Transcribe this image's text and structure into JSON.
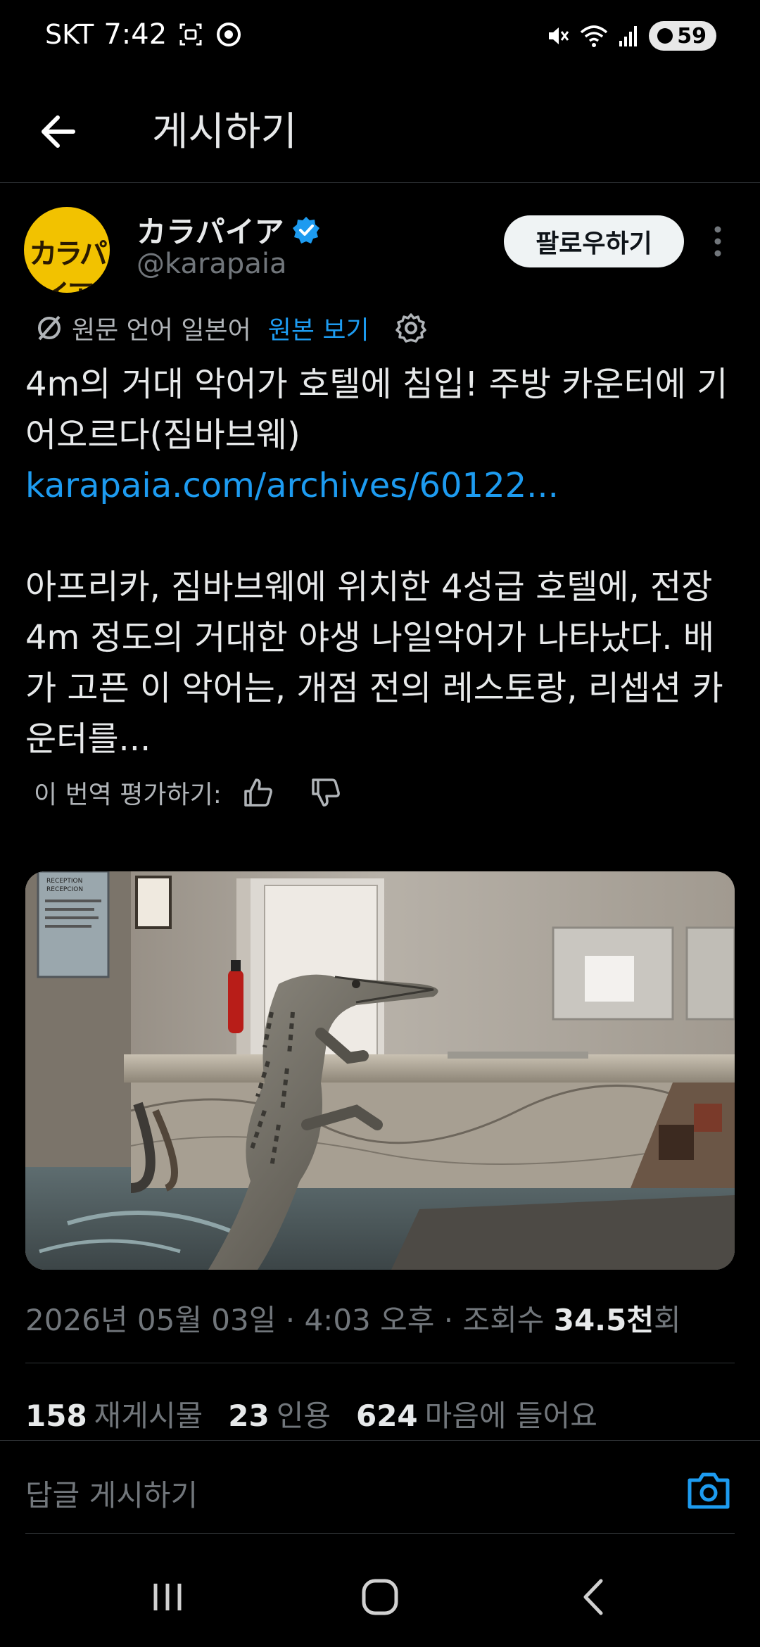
{
  "status_bar": {
    "carrier": "SKT",
    "time": "7:42",
    "battery": "59"
  },
  "header": {
    "title": "게시하기"
  },
  "author": {
    "avatar_text": "カラパイア",
    "display_name": "カラパイア",
    "handle": "@karapaia",
    "follow_label": "팔로우하기"
  },
  "translation": {
    "label": "원문 언어 일본어",
    "view_original": "원본 보기"
  },
  "tweet": {
    "headline": "4m의 거대 악어가 호텔에 침입! 주방 카운터에 기어오르다(짐바브웨)",
    "link": "karapaia.com/archives/60122...",
    "body": "아프리카, 짐바브웨에 위치한 4성급 호텔에, 전장 4m 정도의 거대한 야생 나일악어가 나타났다. 배가 고픈 이 악어는, 개점 전의 레스토랑, 리셉션 카운터를...",
    "rate_label": "이 번역 평가하기:"
  },
  "media": {
    "sign_text": "RECEPTION\nRECEPCION"
  },
  "meta": {
    "timestamp": "2026년 05월 03일 · 4:03 오후 · 조회수 ",
    "views": "34.5천",
    "views_suffix": "회"
  },
  "stats": {
    "reposts_count": "158",
    "reposts_label": "재게시물",
    "quotes_count": "23",
    "quotes_label": "인용",
    "likes_count": "624",
    "likes_label": "마음에 들어요"
  },
  "reply": {
    "placeholder": "답글 게시하기"
  },
  "colors": {
    "accent": "#1d9bf0",
    "background": "#000000",
    "muted": "#71767b"
  }
}
